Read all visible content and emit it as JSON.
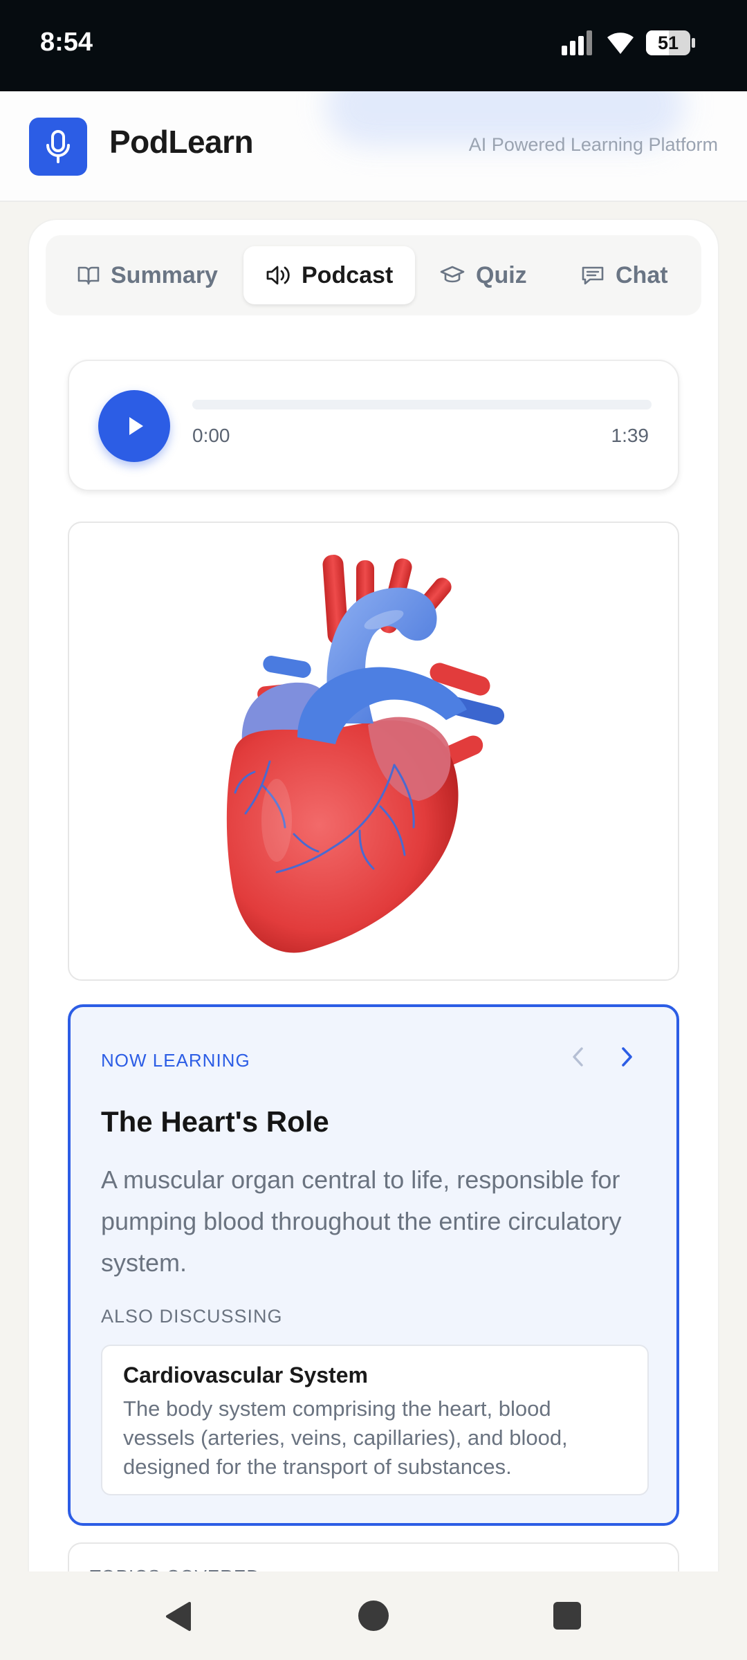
{
  "status_bar": {
    "time": "8:54",
    "battery_level": "51",
    "battery_fraction": 0.51
  },
  "header": {
    "app_name": "PodLearn",
    "tagline": "AI Powered Learning Platform"
  },
  "tabs": [
    {
      "label": "Summary",
      "icon": "book-open-icon",
      "active": false
    },
    {
      "label": "Podcast",
      "icon": "speaker-icon",
      "active": true
    },
    {
      "label": "Quiz",
      "icon": "graduation-cap-icon",
      "active": false
    },
    {
      "label": "Chat",
      "icon": "message-square-icon",
      "active": false
    }
  ],
  "player": {
    "current_time": "0:00",
    "duration": "1:39",
    "progress_fraction": 0.0
  },
  "illustration": {
    "subject": "anatomical heart illustration"
  },
  "now_learning": {
    "label": "NOW LEARNING",
    "title": "The Heart's Role",
    "description": "A muscular organ central to life, responsible for pumping blood throughout the entire circulatory system.",
    "also_label": "ALSO DISCUSSING",
    "related": {
      "title": "Cardiovascular System",
      "description": "The body system comprising the heart, blood vessels (arteries, veins, capillaries), and blood, designed for the transport of substances."
    }
  },
  "next_section": {
    "label": "TOPICS COVERED"
  },
  "colors": {
    "accent": "#2c5de5",
    "status_bar": "#060c10",
    "background": "#f5f4f0"
  }
}
